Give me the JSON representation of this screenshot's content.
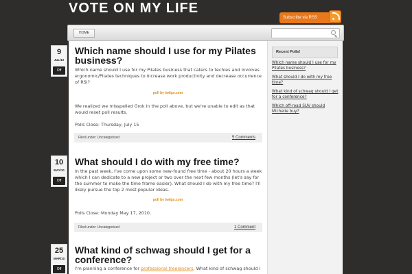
{
  "site": {
    "title": "VOTE ON MY LIFE",
    "rss_label": "Subscribe via RSS"
  },
  "nav": {
    "home": "HOME",
    "search_placeholder": ""
  },
  "posts": [
    {
      "day": "9",
      "month": "JUL/10",
      "badge": "Off",
      "title": "Which name should I use for my Pilates business?",
      "body1": "Which name should I use for my Pilates business that caters to techies and involves ergonomic/Pilates techniques to increase work productivity and decrease occurrence of RSI?",
      "poll_by": "poll by twiigs.com",
      "body2": "We realized we misspelled Grok in the poll above, but we're unable to edit as that would reset poll results.",
      "close": "Polls Close: Thursday, July 15",
      "filed": "Filed under:",
      "category": "Uncategorized",
      "comments": "5 Comments"
    },
    {
      "day": "10",
      "month": "MAY/10",
      "badge": "Off",
      "title": "What should I do with my free time?",
      "body1": "In the past week, I've come upon some new-found free time - about 20 hours a week which I can dedicate to a new project or two over the next few months (let's say for the summer to make the time frame easier). What should I do with my free time? I'll likely pursue the top 2 most popular ideas.",
      "poll_by": "poll by twiigs.com",
      "close": "Polls Close: Monday May 17, 2010.",
      "filed": "Filed under:",
      "category": "Uncategorized",
      "comments": "1 Comment"
    },
    {
      "day": "25",
      "month": "MAR/10",
      "badge": "Off",
      "title": "What kind of schwag should I get for a conference?",
      "body_start": "I'm planning a conference for ",
      "body_link": "professional freelancers",
      "body_end": ". What kind of schwag should I"
    }
  ],
  "sidebar": {
    "title": "Recent Polls!",
    "items": [
      "Which name should I use for my Pilates business?",
      "What should I do with my free time?",
      "What kind of schwag should I get for a conference?",
      "Which off-road SUV should Michelle buy?"
    ]
  },
  "colors": {
    "background": "#2e2d2b",
    "accent": "#e08a10",
    "rss": "#e8781c"
  }
}
